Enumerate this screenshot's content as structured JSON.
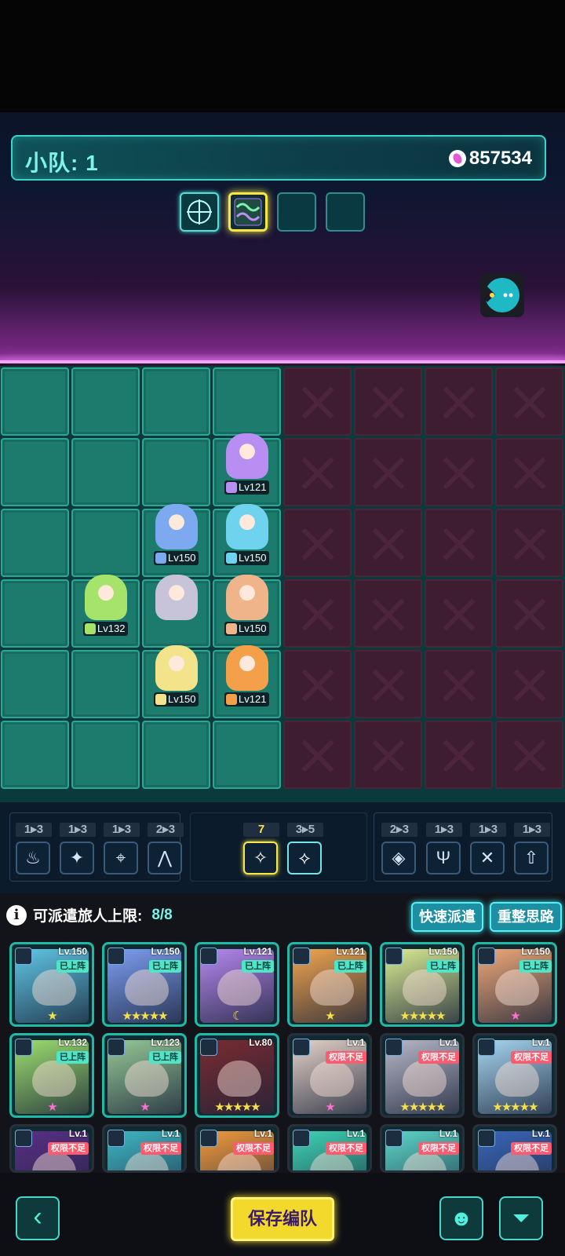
{
  "squad": {
    "label": "小队: 1",
    "power": "857534"
  },
  "formation_slots": [
    {
      "icon": "crosshair-grid-icon",
      "state": "active"
    },
    {
      "icon": "wave-circuit-icon",
      "state": "selected"
    },
    {
      "icon": "",
      "state": "empty"
    },
    {
      "icon": "",
      "state": "empty"
    }
  ],
  "chat": {
    "icon": "chat-bubble-icon"
  },
  "board_heroes": [
    {
      "level": "Lv121",
      "color": "#b88ef2",
      "col": 3,
      "row": 1
    },
    {
      "level": "Lv150",
      "color": "#7da9f0",
      "col": 2,
      "row": 2
    },
    {
      "level": "Lv150",
      "color": "#6fd3f0",
      "col": 3,
      "row": 2
    },
    {
      "level": "Lv132",
      "color": "#a6e36a",
      "col": 1,
      "row": 3
    },
    {
      "level": "",
      "color": "#c7c3d8",
      "col": 2,
      "row": 3
    },
    {
      "level": "Lv150",
      "color": "#f0b48a",
      "col": 3,
      "row": 3
    },
    {
      "level": "Lv150",
      "color": "#f3e38a",
      "col": 2,
      "row": 4
    },
    {
      "level": "Lv121",
      "color": "#f4a04b",
      "col": 3,
      "row": 4
    }
  ],
  "camps_left": [
    {
      "count": "1▸3",
      "icon": "flame-icon",
      "glyph": "♨"
    },
    {
      "count": "1▸3",
      "icon": "shuriken-icon",
      "glyph": "✦"
    },
    {
      "count": "1▸3",
      "icon": "arrow-shield-icon",
      "glyph": "⌖"
    },
    {
      "count": "2▸3",
      "icon": "mountain-icon",
      "glyph": "⋀"
    }
  ],
  "camps_middle": [
    {
      "count": "7",
      "icon": "star-burst-icon",
      "glyph": "✧"
    },
    {
      "count": "3▸5",
      "icon": "crest-icon",
      "glyph": "⟡"
    }
  ],
  "camps_right": [
    {
      "count": "2▸3",
      "icon": "diamond-crest-icon",
      "glyph": "◈"
    },
    {
      "count": "1▸3",
      "icon": "helmet-icon",
      "glyph": "Ψ"
    },
    {
      "count": "1▸3",
      "icon": "crossed-swords-icon",
      "glyph": "✕"
    },
    {
      "count": "1▸3",
      "icon": "up-arrow-icon",
      "glyph": "⇧"
    }
  ],
  "dispatch": {
    "label": "可派遣旅人上限:",
    "value": "8/8",
    "quick_label": "快速派遣",
    "reset_label": "重整思路"
  },
  "roster": [
    {
      "level": "Lv.150",
      "tag": "已上阵",
      "status": "deployed",
      "color": "#5fc7e6",
      "stars": "★",
      "star_color": "yellow"
    },
    {
      "level": "Lv.150",
      "tag": "已上阵",
      "status": "deployed",
      "color": "#7d9ff3",
      "stars": "★★★★★",
      "star_color": "yellow"
    },
    {
      "level": "Lv.121",
      "tag": "已上阵",
      "status": "deployed",
      "color": "#b788ef",
      "stars": "☾",
      "star_color": "yellow"
    },
    {
      "level": "Lv.121",
      "tag": "已上阵",
      "status": "deployed",
      "color": "#f2a54f",
      "stars": "★",
      "star_color": "yellow"
    },
    {
      "level": "Lv.150",
      "tag": "已上阵",
      "status": "deployed",
      "color": "#d9ec93",
      "stars": "★★★★★",
      "star_color": "yellow"
    },
    {
      "level": "Lv.150",
      "tag": "已上阵",
      "status": "deployed",
      "color": "#f0a979",
      "stars": "★",
      "star_color": "pink"
    },
    {
      "level": "Lv.132",
      "tag": "已上阵",
      "status": "deployed",
      "color": "#9ddf6f",
      "stars": "★",
      "star_color": "pink"
    },
    {
      "level": "Lv.123",
      "tag": "已上阵",
      "status": "deployed",
      "color": "#96c996",
      "stars": "★",
      "star_color": "pink"
    },
    {
      "level": "Lv.80",
      "tag": "",
      "status": "none",
      "color": "#7a2b31",
      "stars": "★★★★★",
      "star_color": "yellow"
    },
    {
      "level": "Lv.1",
      "tag": "权限不足",
      "status": "lack",
      "color": "#e5d2c8",
      "stars": "★",
      "star_color": "pink"
    },
    {
      "level": "Lv.1",
      "tag": "权限不足",
      "status": "lack",
      "color": "#b7b8c8",
      "stars": "★★★★★",
      "star_color": "yellow"
    },
    {
      "level": "Lv.1",
      "tag": "权限不足",
      "status": "lack",
      "color": "#a7d6f0",
      "stars": "★★★★★",
      "star_color": "yellow"
    },
    {
      "level": "Lv.1",
      "tag": "权限不足",
      "status": "lack",
      "color": "#5a2f86",
      "stars": "",
      "star_color": "yellow"
    },
    {
      "level": "Lv.1",
      "tag": "权限不足",
      "status": "lack",
      "color": "#3fb7c4",
      "stars": "",
      "star_color": "yellow"
    },
    {
      "level": "Lv.1",
      "tag": "权限不足",
      "status": "lack",
      "color": "#f29a3c",
      "stars": "",
      "star_color": "yellow"
    },
    {
      "level": "Lv.1",
      "tag": "权限不足",
      "status": "lack",
      "color": "#3ed4b4",
      "stars": "",
      "star_color": "yellow"
    },
    {
      "level": "Lv.1",
      "tag": "权限不足",
      "status": "lack",
      "color": "#5cd6c8",
      "stars": "",
      "star_color": "yellow"
    },
    {
      "level": "Lv.1",
      "tag": "权限不足",
      "status": "lack",
      "color": "#3a66b8",
      "stars": "",
      "star_color": "yellow"
    }
  ],
  "bottom": {
    "back_icon": "chevron-left-icon",
    "back_glyph": "‹",
    "save_label": "保存编队",
    "brain_icon": "brain-head-icon",
    "brain_glyph": "☻",
    "filter_icon": "filter-icon",
    "filter_glyph": "⏷"
  }
}
